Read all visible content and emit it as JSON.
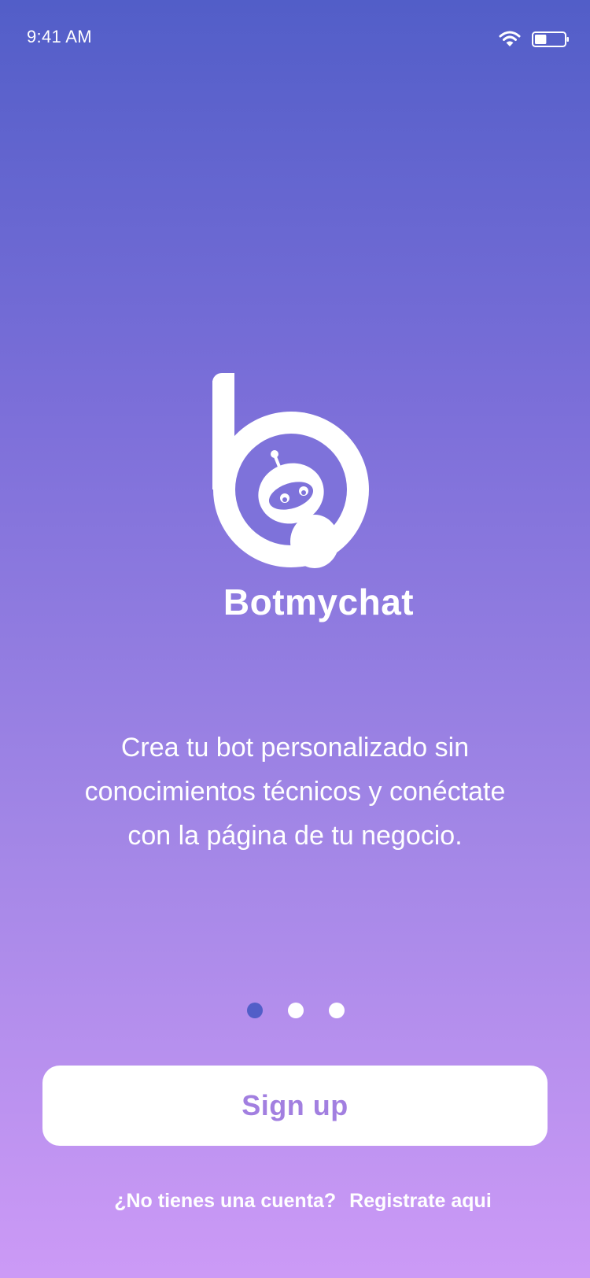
{
  "status_bar": {
    "time": "9:41 AM",
    "icons": [
      "wifi-icon",
      "battery-icon"
    ],
    "battery_level": 0.4
  },
  "brand": {
    "logo_icon": "robot-b-logo",
    "name": "Botmychat"
  },
  "onboarding": {
    "description": "Crea tu bot personalizado sin conocimientos técnicos y conéctate con la página de tu negocio.",
    "pages": 3,
    "active_page": 1
  },
  "actions": {
    "signup_label": "Sign up"
  },
  "footer": {
    "question": "¿No tienes una cuenta?",
    "register_link": "Registrate aqui"
  },
  "colors": {
    "gradient_top": "#525ec8",
    "gradient_bottom": "#cc9af6",
    "active_dot": "#525ec8",
    "button_text": "#a27fe0",
    "white": "#ffffff"
  }
}
